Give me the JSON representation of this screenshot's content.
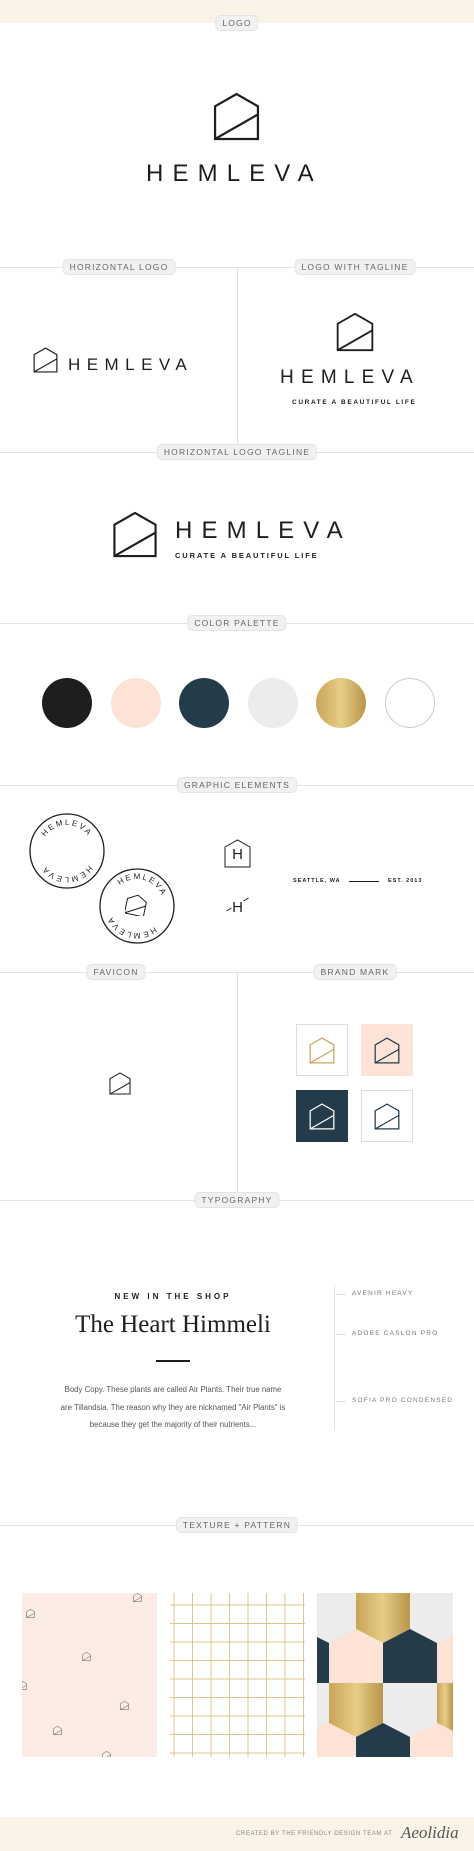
{
  "brand": {
    "name": "HEMLEVA",
    "tagline": "CURATE A BEAUTIFUL LIFE"
  },
  "sections": {
    "logo": "LOGO",
    "horizontal_logo": "HORIZONTAL LOGO",
    "logo_with_tagline": "LOGO WITH TAGLINE",
    "horizontal_logo_tagline": "HORIZONTAL LOGO TAGLINE",
    "color_palette": "COLOR PALETTE",
    "graphic_elements": "GRAPHIC ELEMENTS",
    "favicon": "FAVICON",
    "brand_mark": "BRAND MARK",
    "typography": "TYPOGRAPHY",
    "texture_pattern": "TEXTURE + PATTERN"
  },
  "palette": [
    "#1e1e1e",
    "#fce3d6",
    "#243c4a",
    "#ececec",
    "#d4b46a",
    "#ffffff"
  ],
  "graphic_elements": {
    "stamp_text": "HEMLEVA",
    "monogram": "H",
    "location": "SEATTLE, WA",
    "established": "EST. 2013"
  },
  "typography": {
    "kicker": "NEW IN THE SHOP",
    "title": "The Heart Himmeli",
    "body": [
      "Body Copy. These plants are called Air Plants. Their true name",
      "are Tillandsia. The reason why they are nicknamed \"Air Plants\" is",
      "because they get the majority of their nutrients..."
    ],
    "fonts": [
      "AVENIR HEAVY",
      "ADOBE CASLON PRO",
      "SOFIA PRO CONDENSED"
    ]
  },
  "footer": {
    "credit": "CREATED BY THE FRIENDLY DESIGN TEAM AT",
    "studio": "Aeolidia"
  }
}
